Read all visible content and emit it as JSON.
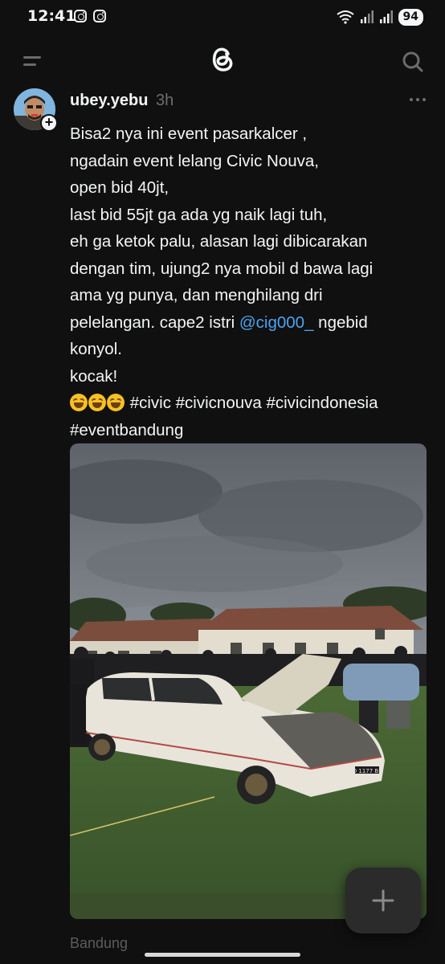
{
  "status_bar": {
    "time": "12:41",
    "battery": "94"
  },
  "nav": {
    "menu_icon": "menu-icon",
    "logo_icon": "threads-logo-icon",
    "search_icon": "search-icon"
  },
  "post": {
    "username": "ubey.yebu",
    "time": "3h",
    "text_lines": [
      "Bisa2 nya ini event pasarkalcer ,",
      "ngadain event lelang Civic Nouva,",
      "open bid 40jt,",
      "last bid 55jt ga ada yg naik lagi tuh,",
      "eh ga ketok palu, alasan lagi dibicarakan",
      "dengan tim, ujung2 nya mobil d bawa lagi",
      "ama yg punya, dan menghilang dri"
    ],
    "line8_before": "pelelangan. cape2 istri ",
    "mention": "@cig000_",
    "line8_after": " ngebid",
    "line9": "konyol.",
    "line10": "kocak!",
    "hashtags_line1": "#civic #civicnouva #civicindonesia",
    "hashtags_line2": "#eventbandung",
    "emoji_name": "rolling-on-floor-laughing",
    "location": "Bandung",
    "license_plate": "D 1177 BF"
  },
  "colors": {
    "background": "#101010",
    "text": "#f3f5f7",
    "muted": "#6d6d6d",
    "mention": "#4aa4ef"
  }
}
